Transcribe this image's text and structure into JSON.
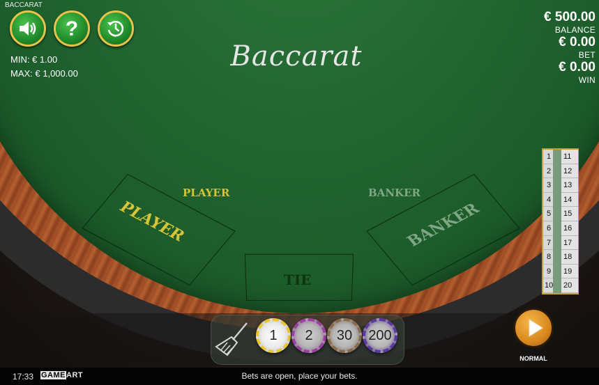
{
  "header": {
    "game_label": "BACCARAT",
    "buttons": [
      {
        "name": "sound-button",
        "icon": "speaker-icon"
      },
      {
        "name": "help-button",
        "icon": "question-icon"
      },
      {
        "name": "history-button",
        "icon": "history-clock-icon"
      }
    ]
  },
  "limits": {
    "min": "MIN: € 1.00",
    "max": "MAX: € 1,000.00"
  },
  "stats": {
    "balance_value": "€ 500.00",
    "balance_label": "BALANCE",
    "bet_value": "€ 0.00",
    "bet_label": "BET",
    "win_value": "€ 0.00",
    "win_label": "WIN"
  },
  "table": {
    "title": "Baccarat",
    "player_small": "PLAYER",
    "banker_small": "BANKER",
    "player_zone": "PLAYER",
    "tie_zone": "TIE",
    "banker_zone": "BANKER"
  },
  "history": {
    "left_column": [
      "1",
      "2",
      "3",
      "4",
      "5",
      "6",
      "7",
      "8",
      "9",
      "10"
    ],
    "right_column": [
      "11",
      "12",
      "13",
      "14",
      "15",
      "16",
      "17",
      "18",
      "19",
      "20"
    ]
  },
  "chips": {
    "clear_icon": "broom-icon",
    "values": [
      "1",
      "2",
      "30",
      "200"
    ]
  },
  "play": {
    "icon": "play-icon",
    "label": "NORMAL"
  },
  "status": {
    "time": "17:33",
    "brand_a": "GAME",
    "brand_b": "ART",
    "message": "Bets are open, place your bets."
  },
  "colors": {
    "felt": "#216530",
    "player_text": "#d7c436",
    "banker_text": "#7fa786",
    "button_green": "#1f8a2a",
    "gold_border": "#e9c24a",
    "play_orange": "#d8881f"
  }
}
